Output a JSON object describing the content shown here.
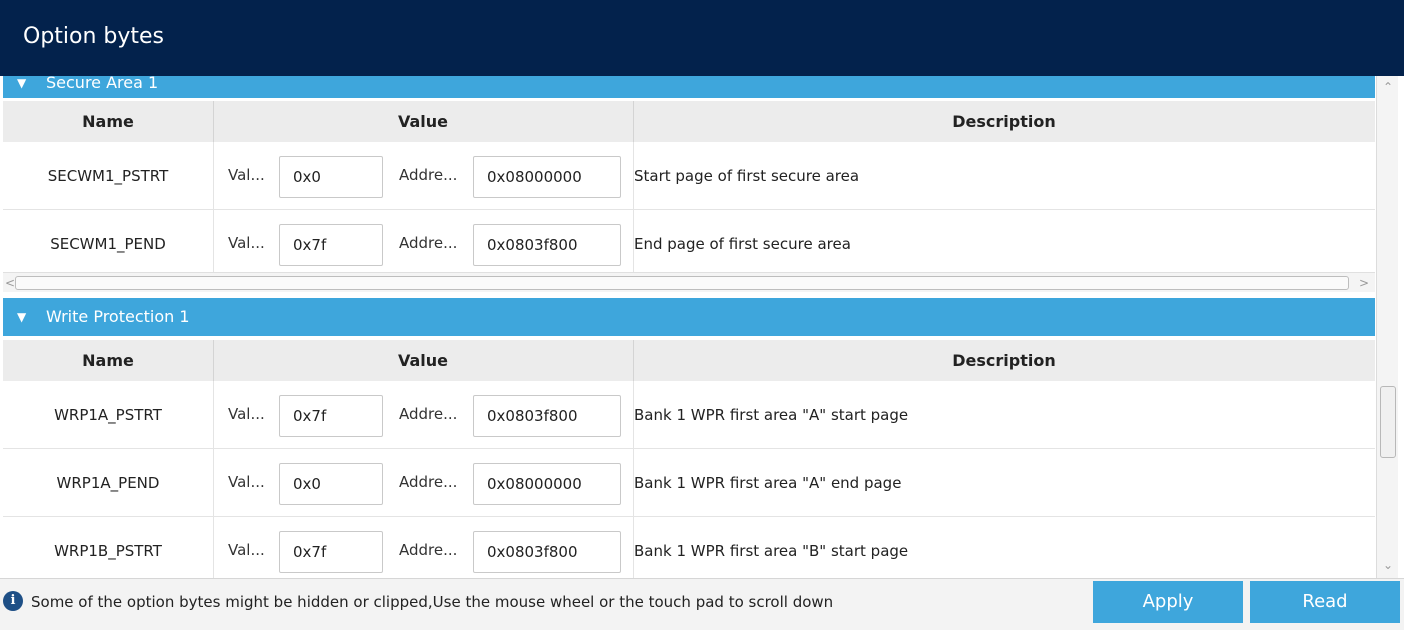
{
  "window": {
    "title": "Option bytes"
  },
  "columns": {
    "name": "Name",
    "value": "Value",
    "description": "Description"
  },
  "field_labels": {
    "value": "Val...",
    "address": "Addre..."
  },
  "sections": [
    {
      "label": "Secure Area 1",
      "rows": [
        {
          "name": "SECWM1_PSTRT",
          "value": "0x0",
          "address": "0x08000000",
          "description": "Start page of first secure area"
        },
        {
          "name": "SECWM1_PEND",
          "value": "0x7f",
          "address": "0x0803f800",
          "description": "End page of first secure area"
        }
      ]
    },
    {
      "label": "Write Protection 1",
      "rows": [
        {
          "name": "WRP1A_PSTRT",
          "value": "0x7f",
          "address": "0x0803f800",
          "description": "Bank 1 WPR first area \"A\" start page"
        },
        {
          "name": "WRP1A_PEND",
          "value": "0x0",
          "address": "0x08000000",
          "description": "Bank 1 WPR first area \"A\" end page"
        },
        {
          "name": "WRP1B_PSTRT",
          "value": "0x7f",
          "address": "0x0803f800",
          "description": "Bank 1 WPR first area \"B\" start page"
        }
      ]
    }
  ],
  "footer": {
    "info_icon": "info-icon",
    "message": "Some of the option bytes might be hidden or clipped,Use the mouse wheel or the touch pad to scroll down",
    "apply_label": "Apply",
    "read_label": "Read"
  },
  "colors": {
    "titlebar": "#03224c",
    "accent": "#3ea6dc"
  }
}
